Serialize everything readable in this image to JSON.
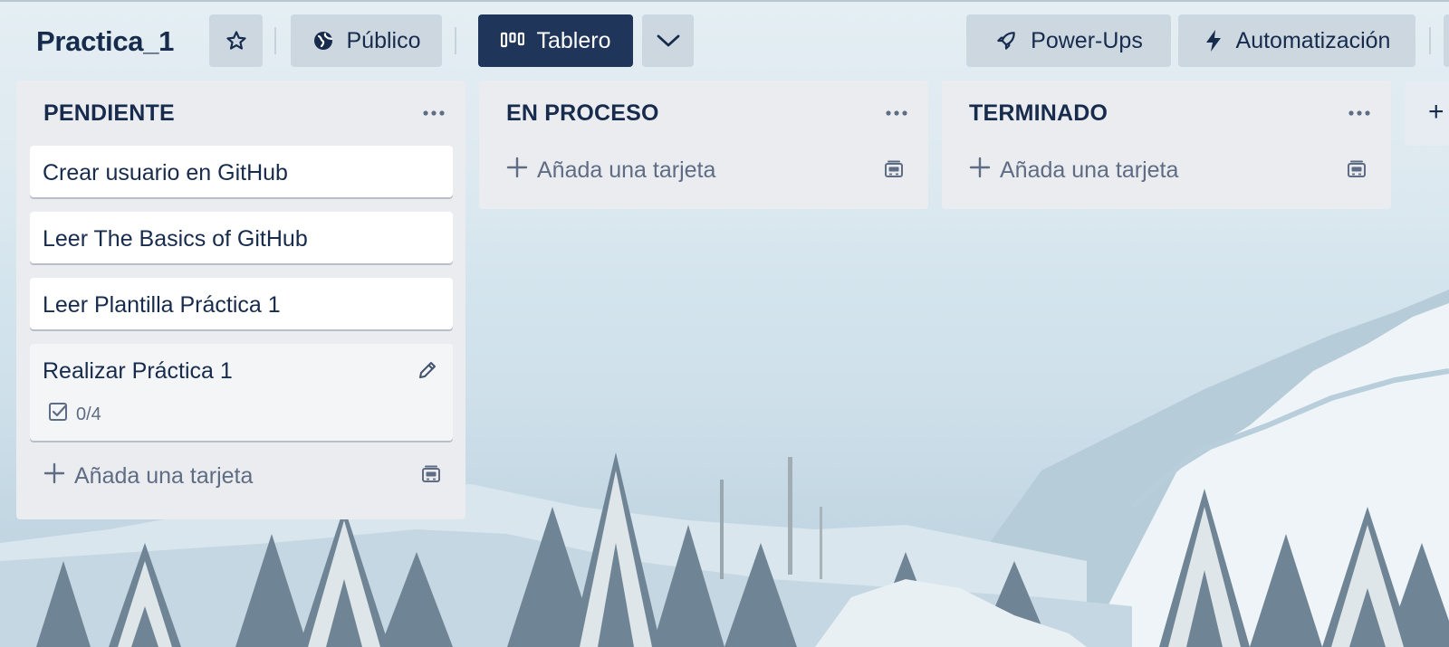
{
  "board": {
    "title": "Practica_1",
    "visibility_label": "Público",
    "view_label": "Tablero",
    "powerups_label": "Power-Ups",
    "automation_label": "Automatización"
  },
  "lists": [
    {
      "title": "PENDIENTE",
      "cards": [
        {
          "title": "Crear usuario en GitHub"
        },
        {
          "title": "Leer The Basics of GitHub"
        },
        {
          "title": "Leer Plantilla Práctica 1"
        },
        {
          "title": "Realizar Práctica 1",
          "checklist": "0/4"
        }
      ],
      "add_card_label": "Añada una tarjeta"
    },
    {
      "title": "EN PROCESO",
      "cards": [],
      "add_card_label": "Añada una tarjeta"
    },
    {
      "title": "TERMINADO",
      "cards": [],
      "add_card_label": "Añada una tarjeta"
    }
  ],
  "add_list_label": "+",
  "icons": {
    "star": "star-icon",
    "visibility": "globe-icon",
    "view": "board-icon",
    "switch_views": "chevron-down-icon",
    "powerups": "rocket-icon",
    "automation": "lightning-icon",
    "list_menu": "more-icon",
    "add": "plus-icon",
    "template": "card-template-icon",
    "edit": "pencil-icon",
    "checklist": "checklist-icon"
  },
  "colors": {
    "header_active_button": "#1f3559",
    "list_background": "#ebecf0",
    "card_background": "#ffffff",
    "text_primary": "#172b4d",
    "text_muted": "#5e6c84"
  }
}
